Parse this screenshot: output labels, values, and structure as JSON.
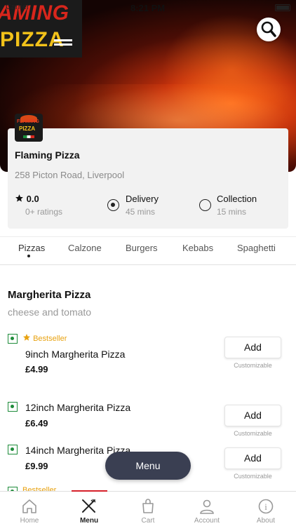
{
  "status_bar": {
    "carrier": "Carrier",
    "time": "8:21 PM"
  },
  "hero": {
    "logo_line1": "AMING",
    "logo_line2": "PIZZA"
  },
  "restaurant": {
    "thumb_line1": "FLAMING",
    "thumb_line2": "PIZZA",
    "name": "Flaming Pizza",
    "address": "258 Picton Road, Liverpool",
    "rating_value": "0.0",
    "rating_count": "0+ ratings",
    "delivery_label": "Delivery",
    "delivery_time": "45 mins",
    "collection_label": "Collection",
    "collection_time": "15 mins",
    "selected_option": "Delivery"
  },
  "categories": [
    "Pizzas",
    "Calzone",
    "Burgers",
    "Kebabs",
    "Spaghetti"
  ],
  "section": {
    "title": "Margherita Pizza",
    "subtitle": "cheese and tomato"
  },
  "items": [
    {
      "badge": "Bestseller",
      "name": "9inch Margherita Pizza",
      "price": "£4.99",
      "add_label": "Add",
      "note": "Customizable"
    },
    {
      "name": "12inch Margherita Pizza",
      "price": "£6.49",
      "add_label": "Add",
      "note": "Customizable"
    },
    {
      "name": "14inch Margherita Pizza",
      "price": "£9.99",
      "add_label": "Add",
      "note": "Customizable"
    },
    {
      "badge": "Bestseller"
    }
  ],
  "float_button": "Menu",
  "bottom_nav": [
    {
      "label": "Home",
      "icon": "home-icon"
    },
    {
      "label": "Menu",
      "icon": "fork-knife-icon",
      "active": true
    },
    {
      "label": "Cart",
      "icon": "bag-icon"
    },
    {
      "label": "Account",
      "icon": "user-icon"
    },
    {
      "label": "About",
      "icon": "info-icon"
    }
  ],
  "colors": {
    "accent": "#d6202a",
    "veg": "#1e8c3a",
    "bestseller": "#e8a210",
    "float_button": "#3a3f52"
  }
}
